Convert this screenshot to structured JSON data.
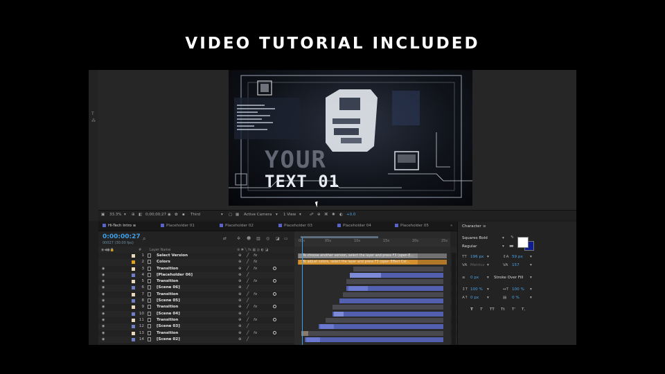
{
  "headline": "VIDEO TUTORIAL INCLUDED",
  "preview": {
    "line1": "YOUR",
    "line2": "TEXT 01"
  },
  "viewer_bar": {
    "zoom": "33.3%",
    "timecode": "0;00;00;27",
    "resolution": "Third",
    "camera": "Active Camera",
    "views": "1 View",
    "exposure": "+0.0"
  },
  "tabs": [
    {
      "label": "Hi-Tech Intro",
      "color": "#5a63c8"
    },
    {
      "label": "Placeholder 01",
      "color": "#5a63c8"
    },
    {
      "label": "Placeholder 02",
      "color": "#5a63c8"
    },
    {
      "label": "Placeholder 03",
      "color": "#5a63c8"
    },
    {
      "label": "Placeholder 04",
      "color": "#5a63c8"
    },
    {
      "label": "Placeholder 05",
      "color": "#5a63c8"
    }
  ],
  "timeline": {
    "timecode": "0:00:00:27",
    "fps": "00027 (30.00 fps)",
    "col_num": "#",
    "col_layer": "Layer Name",
    "ruler": [
      "00s",
      "05s",
      "10s",
      "15s",
      "20s",
      "25s"
    ],
    "layers": [
      {
        "num": "1",
        "name": "Select Version",
        "label": "#e8d8b8"
      },
      {
        "num": "2",
        "name": "Colors",
        "label": "#e0a020"
      },
      {
        "num": "3",
        "name": "Transition",
        "label": "#e8d8b8"
      },
      {
        "num": "4",
        "name": "[Placeholder 06]",
        "label": "#7080c8"
      },
      {
        "num": "5",
        "name": "Transition",
        "label": "#e8d8b8"
      },
      {
        "num": "6",
        "name": "[Scene 06]",
        "label": "#7080c8"
      },
      {
        "num": "7",
        "name": "Transition",
        "label": "#e8d8b8"
      },
      {
        "num": "8",
        "name": "[Scene 05]",
        "label": "#7080c8"
      },
      {
        "num": "9",
        "name": "Transition",
        "label": "#e8d8b8"
      },
      {
        "num": "10",
        "name": "[Scene 04]",
        "label": "#7080c8"
      },
      {
        "num": "11",
        "name": "Transition",
        "label": "#e8d8b8"
      },
      {
        "num": "12",
        "name": "[Scene 03]",
        "label": "#7080c8"
      },
      {
        "num": "13",
        "name": "Transition",
        "label": "#e8d8b8"
      },
      {
        "num": "14",
        "name": "[Scene 02]",
        "label": "#7080c8"
      }
    ],
    "notes": [
      "To choose another version, select the layer and press F3 (open E...",
      "To adjust colors, select the layer and press F3 (open Effect Cor..."
    ]
  },
  "character": {
    "title": "Character",
    "font": "Squares Bold",
    "style": "Regular",
    "font_size": "196 px",
    "leading": "59 px",
    "kerning": "Metrics",
    "tracking": "157",
    "stroke": "0 px",
    "stroke_type": "Stroke Over Fill",
    "vscale": "100 %",
    "hscale": "100 %",
    "baseline": "0 px",
    "tsume": "0 %",
    "text_buttons": [
      "T",
      "T",
      "TT",
      "Tt",
      "T'",
      "T,"
    ]
  }
}
